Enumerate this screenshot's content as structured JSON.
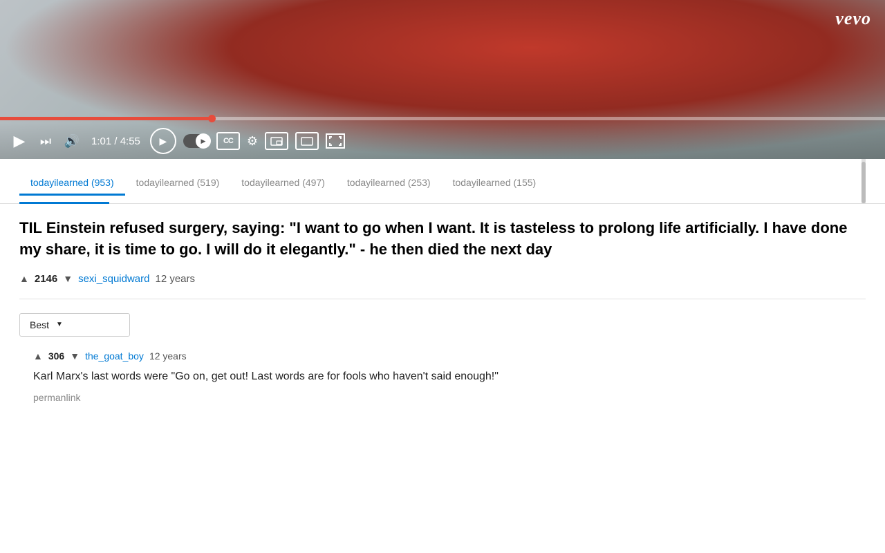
{
  "video": {
    "vevo_label": "vevo",
    "progress_percent": 24,
    "current_time": "1:01",
    "total_time": "4:55",
    "time_display": "1:01 / 4:55"
  },
  "tabs": [
    {
      "label": "todayilearned (953)",
      "active": true
    },
    {
      "label": "todayilearned (519)",
      "active": false
    },
    {
      "label": "todayilearned (497)",
      "active": false
    },
    {
      "label": "todayilearned (253)",
      "active": false
    },
    {
      "label": "todayilearned (155)",
      "active": false
    }
  ],
  "post": {
    "title": "TIL Einstein refused surgery, saying: \"I want to go when I want. It is tasteless to prolong life artificially. I have done my share, it is time to go. I will do it elegantly.\" - he then died the next day",
    "score": "2146",
    "username": "sexi_squidward",
    "timestamp": "12 years"
  },
  "sort": {
    "label": "Best",
    "dropdown_label": "Best"
  },
  "comment": {
    "score": "306",
    "username": "the_goat_boy",
    "timestamp": "12 years",
    "body": "Karl Marx's last words were \"Go on, get out! Last words are for fools who haven't said enough!\"",
    "permalink": "permanlink"
  },
  "controls": {
    "play": "▶",
    "skip": "⏭",
    "volume": "🔊",
    "cc": "CC",
    "settings": "⚙",
    "autoplay_label": "▶"
  }
}
